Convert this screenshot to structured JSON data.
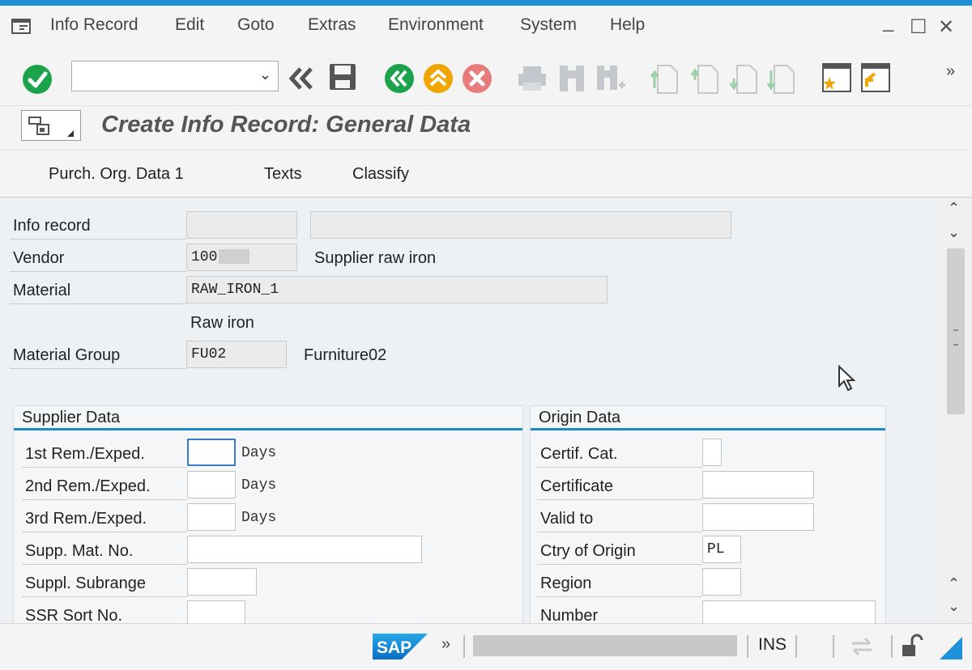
{
  "menubar": {
    "items": [
      "Info Record",
      "Edit",
      "Goto",
      "Extras",
      "Environment",
      "System",
      "Help"
    ],
    "window_controls": {
      "minimize": "_",
      "maximize": "☐",
      "close": "✕"
    }
  },
  "toolbar": {
    "command_value": "",
    "more": "»"
  },
  "title": {
    "text": "Create Info Record: General Data"
  },
  "appbar": {
    "buttons": [
      "Purch. Org. Data 1",
      "Texts",
      "Classify"
    ]
  },
  "header": {
    "info_record_label": "Info record",
    "info_record_value": "",
    "info_record_desc": "",
    "vendor_label": "Vendor",
    "vendor_value": "100",
    "vendor_desc": "Supplier raw iron",
    "material_label": "Material",
    "material_value": "RAW_IRON_1",
    "material_desc": "Raw iron",
    "matgroup_label": "Material Group",
    "matgroup_value": "FU02",
    "matgroup_desc": "Furniture02"
  },
  "supplier_data": {
    "title": "Supplier Data",
    "unit": "Days",
    "rows": {
      "rem1": {
        "label": "1st Rem./Exped.",
        "value": ""
      },
      "rem2": {
        "label": "2nd Rem./Exped.",
        "value": ""
      },
      "rem3": {
        "label": "3rd Rem./Exped.",
        "value": ""
      },
      "supp_mat": {
        "label": "Supp. Mat. No.",
        "value": ""
      },
      "subrange": {
        "label": "Suppl. Subrange",
        "value": ""
      },
      "ssr_sort": {
        "label": "SSR Sort No.",
        "value": ""
      }
    }
  },
  "origin_data": {
    "title": "Origin Data",
    "rows": {
      "certcat": {
        "label": "Certif. Cat.",
        "value": ""
      },
      "certificate": {
        "label": "Certificate",
        "value": ""
      },
      "valid_to": {
        "label": "Valid to",
        "value": ""
      },
      "country": {
        "label": "Ctry of Origin",
        "value": "PL"
      },
      "region": {
        "label": "Region",
        "value": ""
      },
      "number": {
        "label": "Number",
        "value": ""
      }
    }
  },
  "statusbar": {
    "more": "»",
    "mode": "INS"
  },
  "colors": {
    "accent_blue": "#1e90d9",
    "ok_green": "#1aa34a",
    "nav_orange": "#f0a500",
    "cancel_red": "#e87c7c",
    "group_underline": "#1a8bc8"
  }
}
